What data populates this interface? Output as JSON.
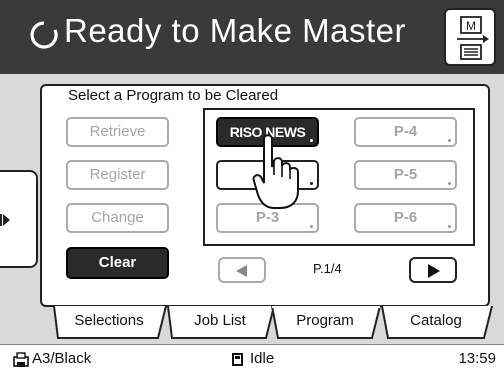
{
  "header": {
    "title": "Ready to Make Master",
    "status_icon": "circular-arrow-icon",
    "master_button_icon": "master-output-icon"
  },
  "panel": {
    "prompt": "Select a Program to be Cleared"
  },
  "actions": [
    {
      "label": "Retrieve",
      "state": "disabled"
    },
    {
      "label": "Register",
      "state": "disabled"
    },
    {
      "label": "Change",
      "state": "disabled"
    },
    {
      "label": "Clear",
      "state": "selected"
    }
  ],
  "programs": [
    {
      "label": "RISO NEWS",
      "style": "selected"
    },
    {
      "label": "",
      "style": "available"
    },
    {
      "label": "P-3",
      "style": "empty"
    },
    {
      "label": "P-4",
      "style": "empty"
    },
    {
      "label": "P-5",
      "style": "empty"
    },
    {
      "label": "P-6",
      "style": "empty"
    }
  ],
  "pagination": {
    "indicator": "P.1/4"
  },
  "tabs": [
    {
      "label": "Selections"
    },
    {
      "label": "Job List"
    },
    {
      "label": "Program",
      "active": true
    },
    {
      "label": "Catalog"
    }
  ],
  "status_bar": {
    "paper": "A3/Black",
    "state": "Idle",
    "time": "13:59"
  },
  "colors": {
    "header_bg": "#3a3a3a",
    "selected_bg": "#2a2a2a",
    "disabled_text": "#a5a5a5"
  }
}
